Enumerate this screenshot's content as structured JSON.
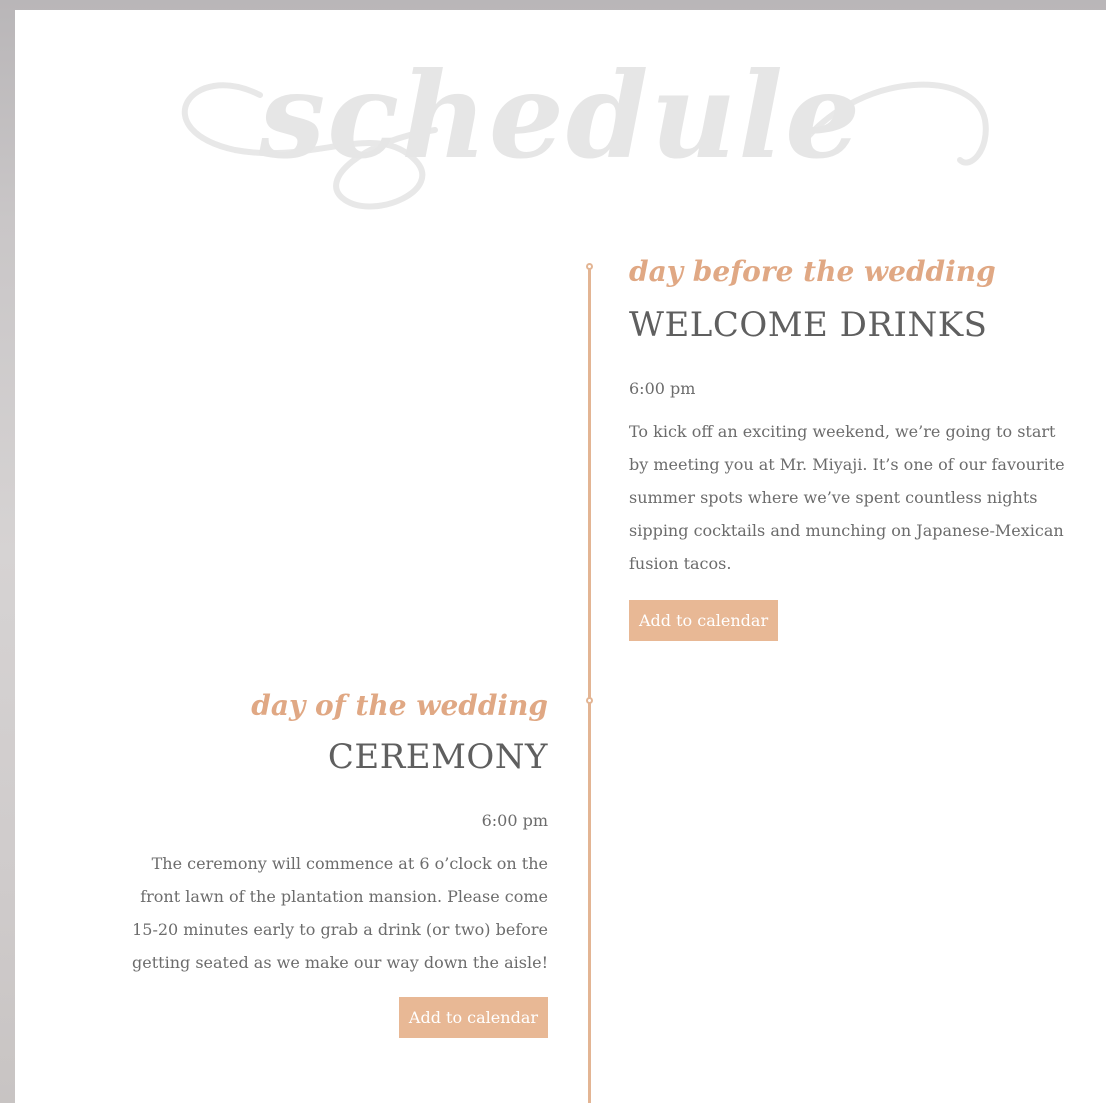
{
  "heading": {
    "script_title": "schedule"
  },
  "colors": {
    "accent": "#e3b594",
    "button_bg": "#e8b895",
    "title_text": "#5f5f5f",
    "body_text": "#6c6c6c",
    "heading_ghost": "#e6e6e6"
  },
  "events": [
    {
      "script_label": "day before the wedding",
      "title": "WELCOME DRINKS",
      "time": "6:00 pm",
      "description": "To kick off an exciting weekend, we’re going to start by meeting you at Mr. Miyaji. It’s one of our favourite summer spots where we’ve spent countless nights sipping cocktails and munching on Japanese-Mexican fusion tacos.",
      "button_label": "Add to calendar"
    },
    {
      "script_label": "day of the wedding",
      "title": "CEREMONY",
      "time": "6:00 pm",
      "description": "The ceremony will commence at 6 o’clock on the front lawn of the plantation mansion. Please come 15-20 minutes early to grab a drink (or two) before getting seated as we make our way down the aisle!",
      "button_label": "Add to calendar"
    }
  ]
}
